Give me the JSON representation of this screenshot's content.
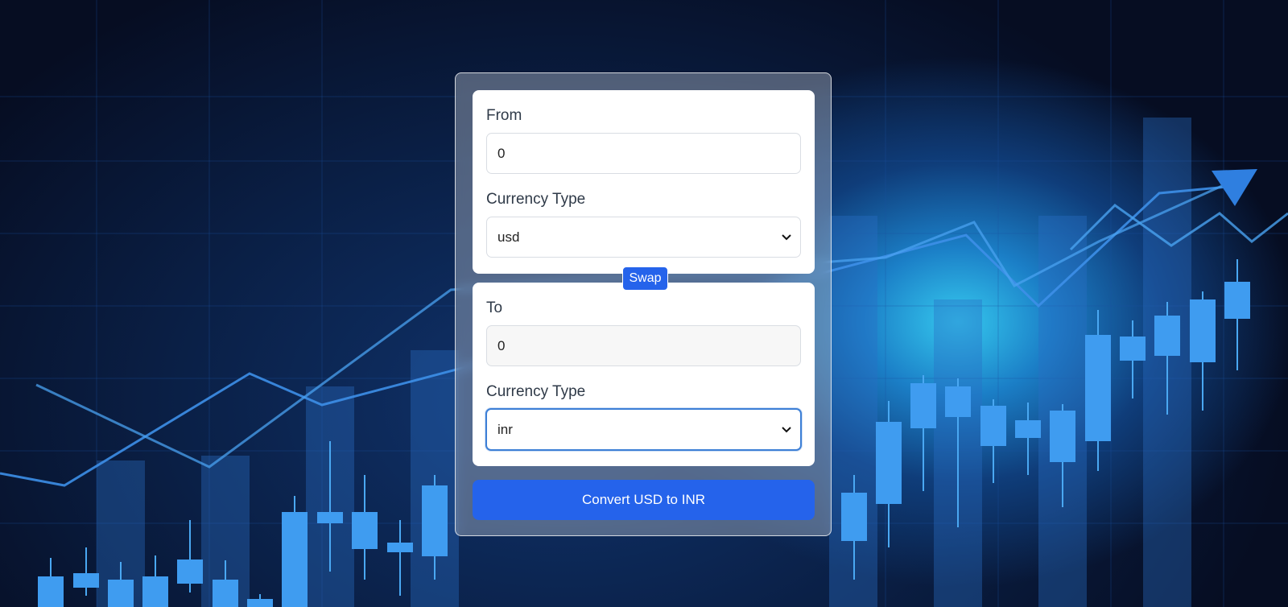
{
  "from": {
    "label": "From",
    "amount_value": "0",
    "currency_label": "Currency Type",
    "currency_selected": "usd"
  },
  "swap_label": "Swap",
  "to": {
    "label": "To",
    "amount_value": "0",
    "currency_label": "Currency Type",
    "currency_selected": "inr"
  },
  "convert_label": "Convert USD to INR",
  "colors": {
    "accent": "#2563eb",
    "focus_ring": "#3d7fd6",
    "background_dark": "#0a1f45",
    "background_glow": "#35c8ee"
  },
  "icons": {
    "select_arrow": "chevron-down-icon",
    "background": "stock-chart-illustration"
  }
}
